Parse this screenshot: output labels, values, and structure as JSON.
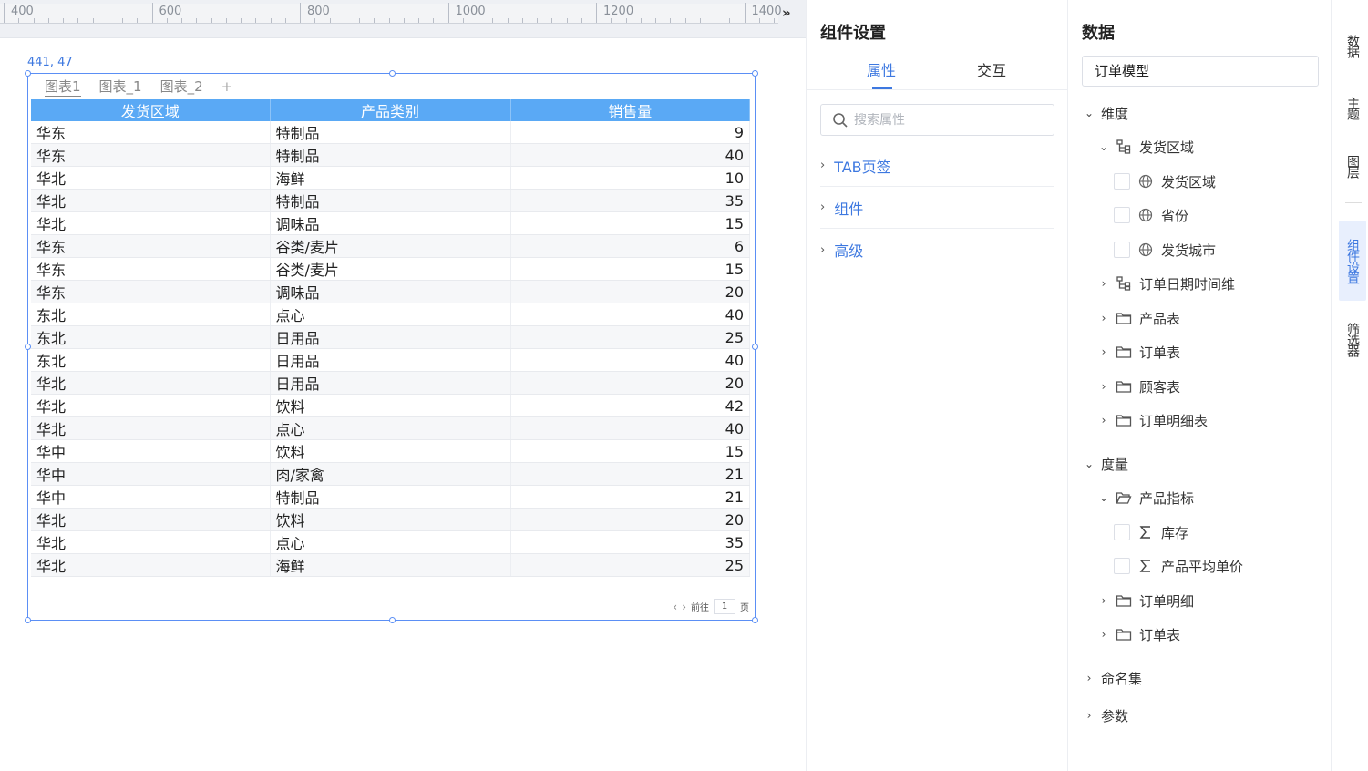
{
  "ruler": {
    "labels": [
      "400",
      "600",
      "800",
      "1000",
      "1200",
      "1400"
    ]
  },
  "canvas": {
    "coord": "441, 47",
    "tabs": [
      "图表1",
      "图表_1",
      "图表_2"
    ],
    "add_tab": "+",
    "table": {
      "headers": [
        "发货区域",
        "产品类别",
        "销售量"
      ],
      "rows": [
        [
          "华东",
          "特制品",
          "9"
        ],
        [
          "华东",
          "特制品",
          "40"
        ],
        [
          "华北",
          "海鲜",
          "10"
        ],
        [
          "华北",
          "特制品",
          "35"
        ],
        [
          "华北",
          "调味品",
          "15"
        ],
        [
          "华东",
          "谷类/麦片",
          "6"
        ],
        [
          "华东",
          "谷类/麦片",
          "15"
        ],
        [
          "华东",
          "调味品",
          "20"
        ],
        [
          "东北",
          "点心",
          "40"
        ],
        [
          "东北",
          "日用品",
          "25"
        ],
        [
          "东北",
          "日用品",
          "40"
        ],
        [
          "华北",
          "日用品",
          "20"
        ],
        [
          "华北",
          "饮料",
          "42"
        ],
        [
          "华北",
          "点心",
          "40"
        ],
        [
          "华中",
          "饮料",
          "15"
        ],
        [
          "华中",
          "肉/家禽",
          "21"
        ],
        [
          "华中",
          "特制品",
          "21"
        ],
        [
          "华北",
          "饮料",
          "20"
        ],
        [
          "华北",
          "点心",
          "35"
        ],
        [
          "华北",
          "海鲜",
          "25"
        ]
      ]
    },
    "pager": {
      "goto_label": "前往",
      "page": "1",
      "page_suffix": "页"
    }
  },
  "settings": {
    "title": "组件设置",
    "tabs": [
      "属性",
      "交互"
    ],
    "search_placeholder": "搜索属性",
    "sections": [
      "TAB页签",
      "组件",
      "高级"
    ]
  },
  "data_panel": {
    "title": "数据",
    "model": "订单模型",
    "dimension_label": "维度",
    "dim_group": "发货区域",
    "dim_fields": [
      "发货区域",
      "省份",
      "发货城市"
    ],
    "dim_other": [
      "订单日期时间维",
      "产品表",
      "订单表",
      "顾客表",
      "订单明细表"
    ],
    "measure_label": "度量",
    "measure_group": "产品指标",
    "measure_fields": [
      "库存",
      "产品平均单价"
    ],
    "measure_other": [
      "订单明细",
      "订单表"
    ],
    "named_set": "命名集",
    "params": "参数"
  },
  "rail": {
    "tabs": [
      "数据",
      "主题",
      "图层",
      "组件设置",
      "筛选器"
    ],
    "active": "组件设置"
  },
  "colors": {
    "accent": "#3d78e0",
    "header": "#5aa9f5",
    "selection": "#5b8ff5"
  }
}
